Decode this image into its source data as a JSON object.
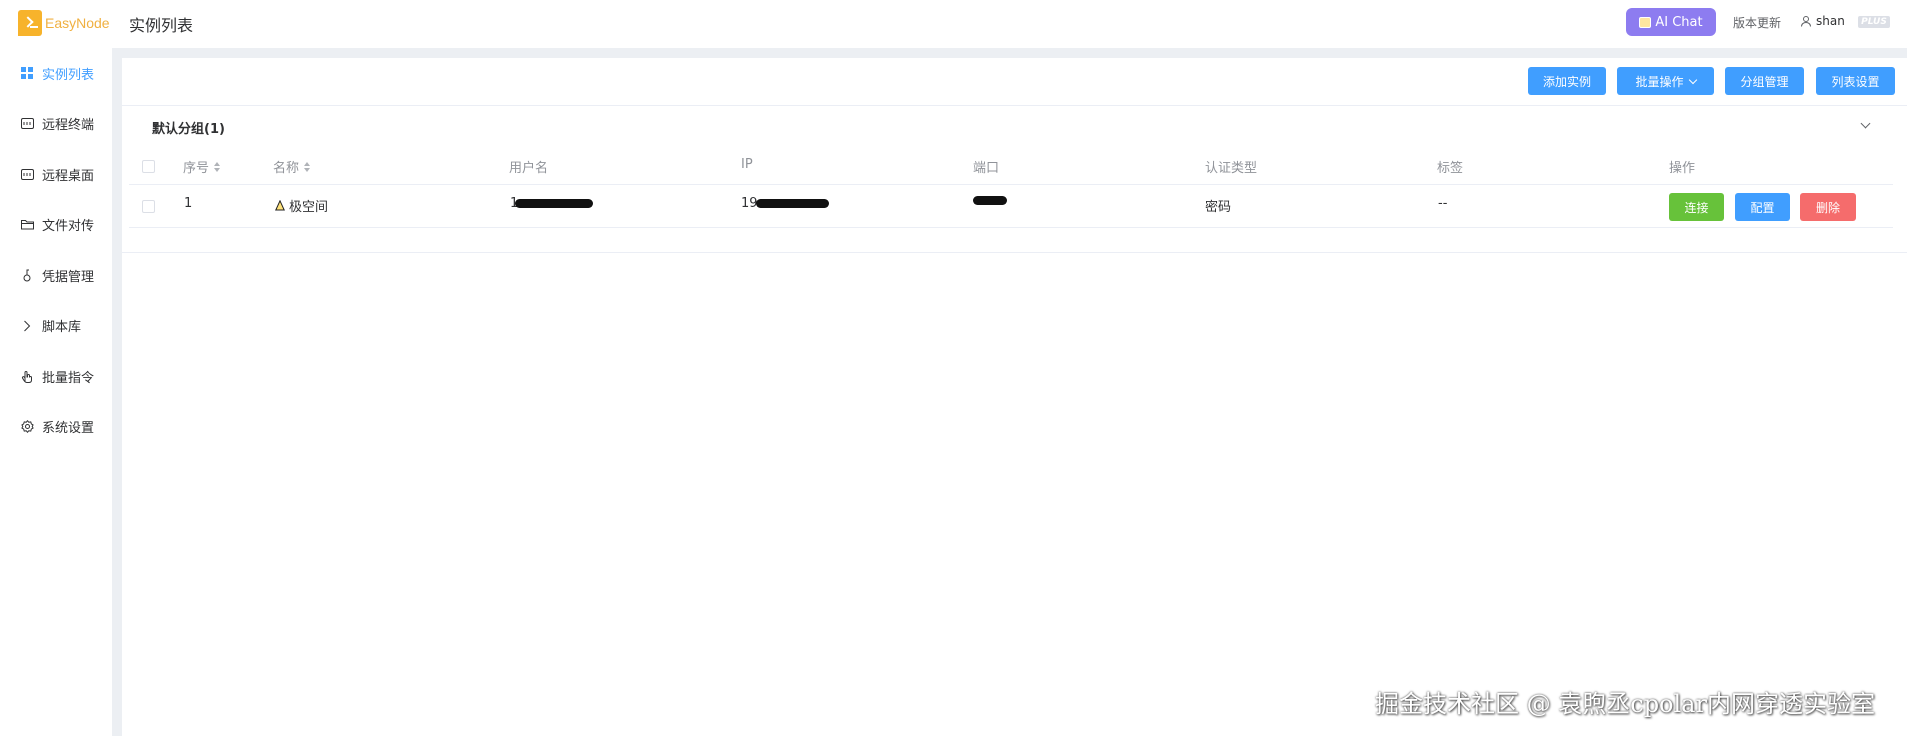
{
  "app": {
    "logo_text": "EasyNode",
    "page_title": "实例列表"
  },
  "header": {
    "ai_chat_label": "AI Chat",
    "version_label": "版本更新",
    "user_name": "shan",
    "plus_badge": "PLUS"
  },
  "sidebar": {
    "items": [
      {
        "label": "实例列表",
        "icon": "grid-icon",
        "active": true
      },
      {
        "label": "远程终端",
        "icon": "terminal-icon"
      },
      {
        "label": "远程桌面",
        "icon": "desktop-icon"
      },
      {
        "label": "文件对传",
        "icon": "folder-icon"
      },
      {
        "label": "凭据管理",
        "icon": "key-icon"
      },
      {
        "label": "脚本库",
        "icon": "chevron-right-icon"
      },
      {
        "label": "批量指令",
        "icon": "pointer-icon"
      },
      {
        "label": "系统设置",
        "icon": "gear-icon"
      }
    ]
  },
  "toolbar": {
    "add_label": "添加实例",
    "batch_label": "批量操作",
    "group_label": "分组管理",
    "list_settings_label": "列表设置"
  },
  "group": {
    "title": "默认分组(1)"
  },
  "table": {
    "columns": {
      "index": "序号",
      "name": "名称",
      "username": "用户名",
      "ip": "IP",
      "port": "端口",
      "auth": "认证类型",
      "tags": "标签",
      "actions": "操作"
    },
    "rows": [
      {
        "index": "1",
        "name": "极空间",
        "username_prefix": "1",
        "ip_prefix": "19",
        "auth": "密码",
        "tags": "--"
      }
    ],
    "row_actions": {
      "connect": "连接",
      "config": "配置",
      "delete": "删除"
    }
  },
  "watermark": "掘金技术社区 @ 袁煦丞cpolar内网穿透实验室",
  "colors": {
    "primary": "#409eff",
    "success": "#67c23a",
    "danger": "#f56c6c",
    "ai": "#8d7cf0",
    "logo": "#f7b32b"
  }
}
